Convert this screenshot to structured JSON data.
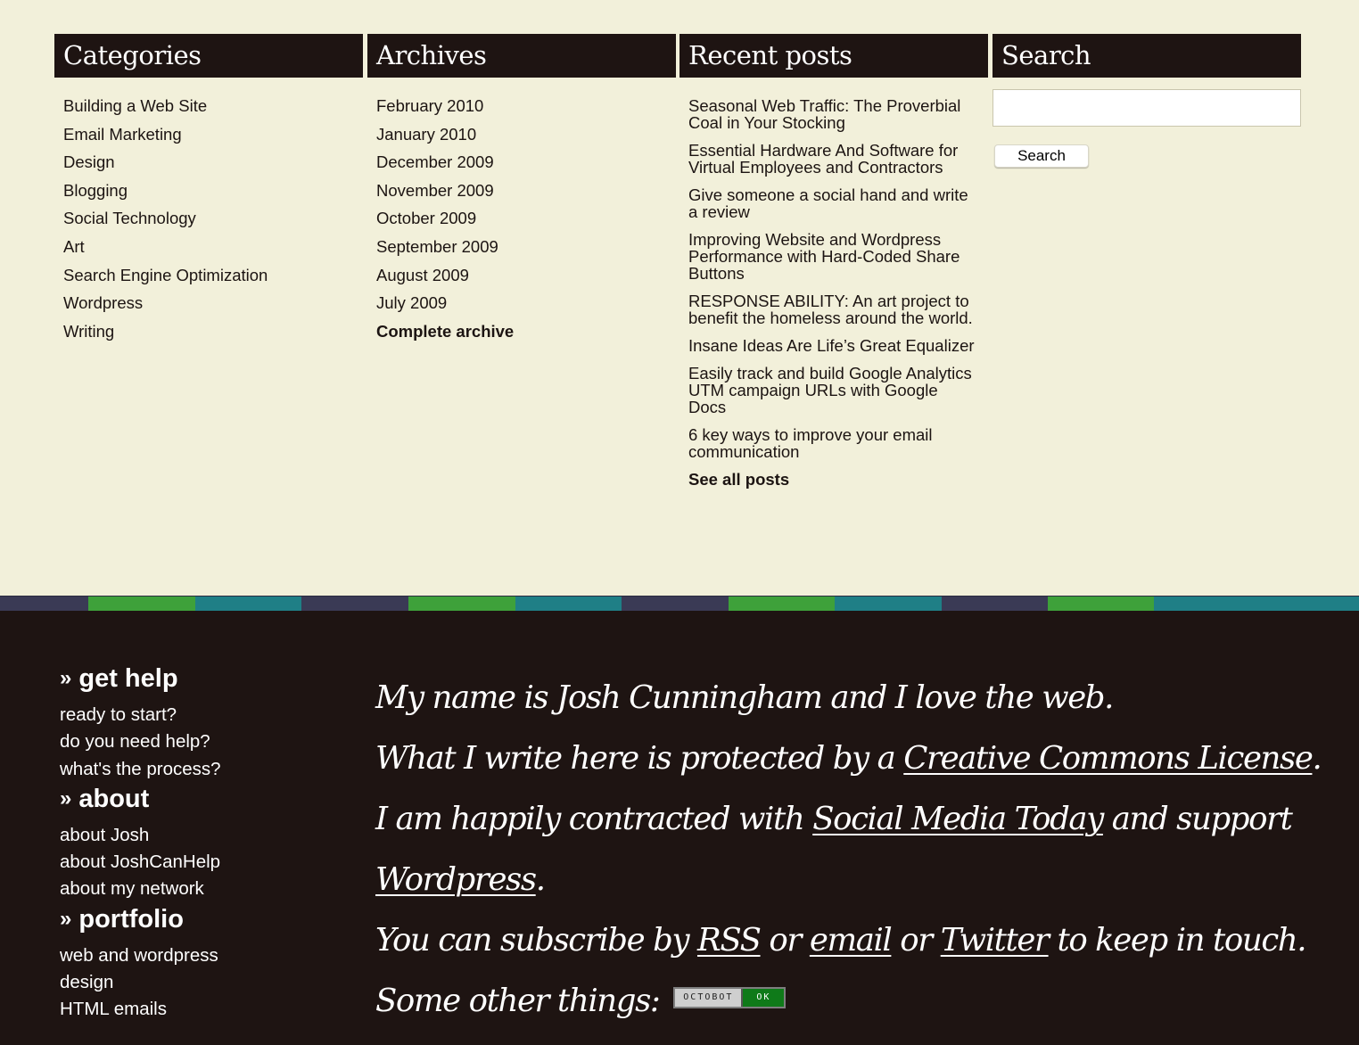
{
  "categories": {
    "title": "Categories",
    "items": [
      "Building a Web Site",
      "Email Marketing",
      "Design",
      "Blogging",
      "Social Technology",
      "Art",
      "Search Engine Optimization",
      "Wordpress",
      "Writing"
    ]
  },
  "archives": {
    "title": "Archives",
    "items": [
      "February 2010",
      "January 2010",
      "December 2009",
      "November 2009",
      "October 2009",
      "September 2009",
      "August 2009",
      "July 2009"
    ],
    "complete_label": "Complete archive"
  },
  "recent": {
    "title": "Recent posts",
    "items": [
      "Seasonal Web Traffic: The Proverbial Coal in Your Stocking",
      "Essential Hardware And Software for Virtual Employees and Contractors",
      "Give someone a social hand and write a review",
      "Improving Website and Wordpress Performance with Hard-Coded Share Buttons",
      "RESPONSE ABILITY: An art project to benefit the homeless around the world.",
      "Insane Ideas Are Life’s Great Equalizer",
      "Easily track and build Google Analytics UTM campaign URLs with Google Docs",
      "6 key ways to improve your email communication"
    ],
    "see_all_label": "See all posts"
  },
  "search": {
    "title": "Search",
    "input_value": "",
    "button_label": "Search"
  },
  "stripe_colors": [
    "#3a3a55",
    "#3ea13a",
    "#1f7f86"
  ],
  "footer_nav": {
    "raquo": "»",
    "groups": [
      {
        "title": "get help",
        "items": [
          "ready to start?",
          "do you need help?",
          "what's the process?"
        ]
      },
      {
        "title": "about",
        "items": [
          "about Josh",
          "about JoshCanHelp",
          "about my network"
        ]
      },
      {
        "title": "portfolio",
        "items": [
          "web and wordpress",
          "design",
          "HTML emails"
        ]
      }
    ]
  },
  "about": {
    "line1": "My name is Josh Cunningham and I love the web.",
    "line2_pre": "What I write here is protected by a ",
    "line2_link": "Creative Commons License",
    "line2_post": ".",
    "line3_pre": "I am happily contracted with ",
    "line3_link1": "Social Media Today",
    "line3_mid": " and support ",
    "line3_link2": "Wordpress",
    "line3_post": ".",
    "line4_pre": "You can subscribe by ",
    "line4_link1": "RSS",
    "line4_or1": " or ",
    "line4_link2": "email",
    "line4_or2": " or ",
    "line4_link3": "Twitter",
    "line4_post": " to keep in touch. Some other things: ",
    "badge_left": "OCTOBOT",
    "badge_right": "OK"
  }
}
